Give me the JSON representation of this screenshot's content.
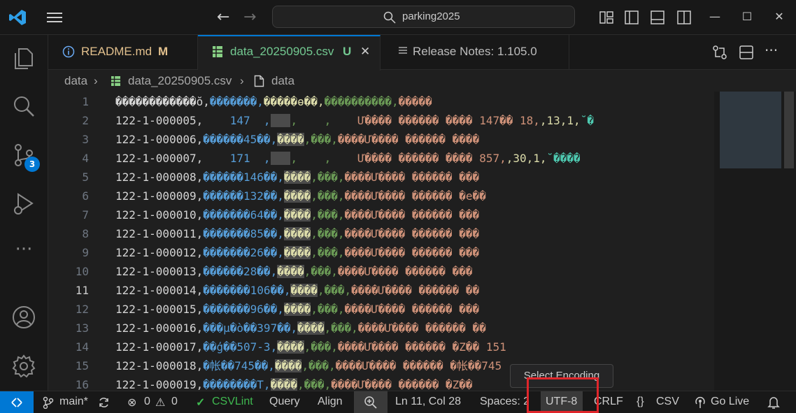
{
  "titlebar": {
    "search_text": "parking2025",
    "icons": [
      "vscode-logo-icon",
      "hamburger-menu-icon",
      "arrow-left-icon",
      "arrow-right-icon",
      "search-icon",
      "customize-layout-icon",
      "toggle-primary-sidebar-icon",
      "toggle-panel-icon",
      "toggle-secondary-sidebar-icon",
      "minimize-icon",
      "maximize-icon",
      "close-icon"
    ],
    "back_glyph": "←",
    "forward_glyph": "→",
    "minimize_glyph": "—",
    "maximize_glyph": "☐",
    "close_glyph": "✕"
  },
  "activitybar": {
    "items": [
      "explorer-icon",
      "search-icon",
      "source-control-icon",
      "run-debug-icon",
      "more-icon",
      "accounts-icon",
      "manage-gear-icon"
    ],
    "source_control_badge": "3",
    "more_glyph": "···"
  },
  "tabs": [
    {
      "label": "README.md",
      "decoration": "M",
      "icon": "info-icon",
      "color": "#e2c08d"
    },
    {
      "label": "data_20250905.csv",
      "decoration": "U",
      "icon": "csv-table-icon",
      "color": "#73c991",
      "active": true
    },
    {
      "label": "Release Notes: 1.105.0",
      "decoration": "",
      "icon": "preview-icon",
      "color": "#cccccc"
    }
  ],
  "tab_close_glyph": "✕",
  "tab_actions": [
    "open-changes-icon",
    "split-editor-icon",
    "more-actions-icon"
  ],
  "tab_more_glyph": "···",
  "breadcrumb": {
    "folder": "data",
    "file": "data_20250905.csv",
    "symbol": "data",
    "sep": "›"
  },
  "editor": {
    "current_line": 11,
    "line_numbers": [
      "1",
      "2",
      "3",
      "4",
      "5",
      "6",
      "7",
      "8",
      "9",
      "10",
      "11",
      "12",
      "13",
      "14",
      "15",
      "16"
    ],
    "lines": [
      [
        {
          "t": "������������ŏ,",
          "c": "c-id"
        },
        {
          "t": "�������,",
          "c": "c-blue"
        },
        {
          "t": "�����ɵ��,",
          "c": "c-yellow"
        },
        {
          "t": "����������,",
          "c": "c-green"
        },
        {
          "t": "�����",
          "c": "c-orange"
        }
      ],
      [
        {
          "t": "122-1-000005,",
          "c": "c-id"
        },
        {
          "t": "    147  ,",
          "c": "c-blue"
        },
        {
          "t": "   ",
          "c": "c-yellow hl"
        },
        {
          "t": ",    ,",
          "c": "c-green"
        },
        {
          "t": "    Ư���� ������ ���� 147�� 18,",
          "c": "c-orange"
        },
        {
          "t": ",13,1,",
          "c": "c-yellow"
        },
        {
          "t": "˘�",
          "c": "c-teal"
        }
      ],
      [
        {
          "t": "122-1-000006,",
          "c": "c-id"
        },
        {
          "t": "������45��,",
          "c": "c-blue"
        },
        {
          "t": "����",
          "c": "c-yellow hl"
        },
        {
          "t": ",���,",
          "c": "c-green"
        },
        {
          "t": "����Ư���� ������ ����",
          "c": "c-orange"
        }
      ],
      [
        {
          "t": "122-1-000007,",
          "c": "c-id"
        },
        {
          "t": "    171  ,",
          "c": "c-blue"
        },
        {
          "t": "   ",
          "c": "c-yellow hl"
        },
        {
          "t": ",    ,",
          "c": "c-green"
        },
        {
          "t": "    Ư���� ������ ���� 857,",
          "c": "c-orange"
        },
        {
          "t": ",30,1,",
          "c": "c-yellow"
        },
        {
          "t": "˘����",
          "c": "c-teal"
        }
      ],
      [
        {
          "t": "122-1-000008,",
          "c": "c-id"
        },
        {
          "t": "������146��,",
          "c": "c-blue"
        },
        {
          "t": "����",
          "c": "c-yellow hl"
        },
        {
          "t": ",���,",
          "c": "c-green"
        },
        {
          "t": "����Ư���� ������ ���",
          "c": "c-orange"
        }
      ],
      [
        {
          "t": "122-1-000009,",
          "c": "c-id"
        },
        {
          "t": "������132��,",
          "c": "c-blue"
        },
        {
          "t": "����",
          "c": "c-yellow hl"
        },
        {
          "t": ",���,",
          "c": "c-green"
        },
        {
          "t": "����Ư���� ������ �e��",
          "c": "c-orange"
        }
      ],
      [
        {
          "t": "122-1-000010,",
          "c": "c-id"
        },
        {
          "t": "�������64��,",
          "c": "c-blue"
        },
        {
          "t": "����",
          "c": "c-yellow hl"
        },
        {
          "t": ",���,",
          "c": "c-green"
        },
        {
          "t": "����Ư���� ������ ���",
          "c": "c-orange"
        }
      ],
      [
        {
          "t": "122-1-000011,",
          "c": "c-id"
        },
        {
          "t": "�������85��,",
          "c": "c-blue"
        },
        {
          "t": "����",
          "c": "c-yellow hl"
        },
        {
          "t": ",���,",
          "c": "c-green"
        },
        {
          "t": "����Ư���� ������ ���",
          "c": "c-orange"
        }
      ],
      [
        {
          "t": "122-1-000012,",
          "c": "c-id"
        },
        {
          "t": "�������26��,",
          "c": "c-blue"
        },
        {
          "t": "����",
          "c": "c-yellow hl"
        },
        {
          "t": ",���,",
          "c": "c-green"
        },
        {
          "t": "����Ư���� ������ ���",
          "c": "c-orange"
        }
      ],
      [
        {
          "t": "122-1-000013,",
          "c": "c-id"
        },
        {
          "t": "������28��,",
          "c": "c-blue"
        },
        {
          "t": "����",
          "c": "c-yellow hl"
        },
        {
          "t": ",���,",
          "c": "c-green"
        },
        {
          "t": "����Ư���� ������ ���",
          "c": "c-orange"
        }
      ],
      [
        {
          "t": "122-1-000014,",
          "c": "c-id"
        },
        {
          "t": "�������106��,",
          "c": "c-blue"
        },
        {
          "t": "����",
          "c": "c-yellow hl"
        },
        {
          "t": ",���,",
          "c": "c-green"
        },
        {
          "t": "����Ư���� ������ ��",
          "c": "c-orange"
        }
      ],
      [
        {
          "t": "122-1-000015,",
          "c": "c-id"
        },
        {
          "t": "�������96��,",
          "c": "c-blue"
        },
        {
          "t": "����",
          "c": "c-yellow hl"
        },
        {
          "t": ",���,",
          "c": "c-green"
        },
        {
          "t": "����Ư���� ������ ���",
          "c": "c-orange"
        }
      ],
      [
        {
          "t": "122-1-000016,",
          "c": "c-id"
        },
        {
          "t": "���µ�ò��397��,",
          "c": "c-blue"
        },
        {
          "t": "����",
          "c": "c-yellow hl"
        },
        {
          "t": ",���,",
          "c": "c-green"
        },
        {
          "t": "����Ư���� ������ ��",
          "c": "c-orange"
        }
      ],
      [
        {
          "t": "122-1-000017,",
          "c": "c-id"
        },
        {
          "t": "��ģ��507-3,",
          "c": "c-blue"
        },
        {
          "t": "����",
          "c": "c-yellow hl"
        },
        {
          "t": ",���,",
          "c": "c-green"
        },
        {
          "t": "����Ư���� ������ �Z�� 151",
          "c": "c-orange"
        }
      ],
      [
        {
          "t": "122-1-000018,",
          "c": "c-id"
        },
        {
          "t": "�帐��745��,",
          "c": "c-blue"
        },
        {
          "t": "����",
          "c": "c-yellow hl"
        },
        {
          "t": ",���,",
          "c": "c-green"
        },
        {
          "t": "����Ư���� ������ �帐��745",
          "c": "c-orange"
        }
      ],
      [
        {
          "t": "122-1-000019,",
          "c": "c-id"
        },
        {
          "t": "��������T,",
          "c": "c-blue"
        },
        {
          "t": "����",
          "c": "c-yellow hl"
        },
        {
          "t": ",���,",
          "c": "c-green"
        },
        {
          "t": "����Ư���� ������ �Z��",
          "c": "c-orange"
        }
      ]
    ]
  },
  "tooltip": "Select Encoding",
  "statusbar": {
    "branch": "main*",
    "errors": "0",
    "warnings": "0",
    "csvlint": "CSVLint",
    "query": "Query",
    "align": "Align",
    "cursor": "Ln 11, Col 28",
    "spaces": "Spaces: 2",
    "encoding": "UTF-8",
    "eol": "CRLF",
    "language": "CSV",
    "golive": "Go Live",
    "braces": "{}",
    "error_glyph": "⊗",
    "warning_glyph": "⚠",
    "check_glyph": "✓"
  },
  "colors": {
    "accent": "#0078d4",
    "highlight_box": "#e0262b",
    "modified": "#e2c08d",
    "untracked": "#73c991"
  }
}
